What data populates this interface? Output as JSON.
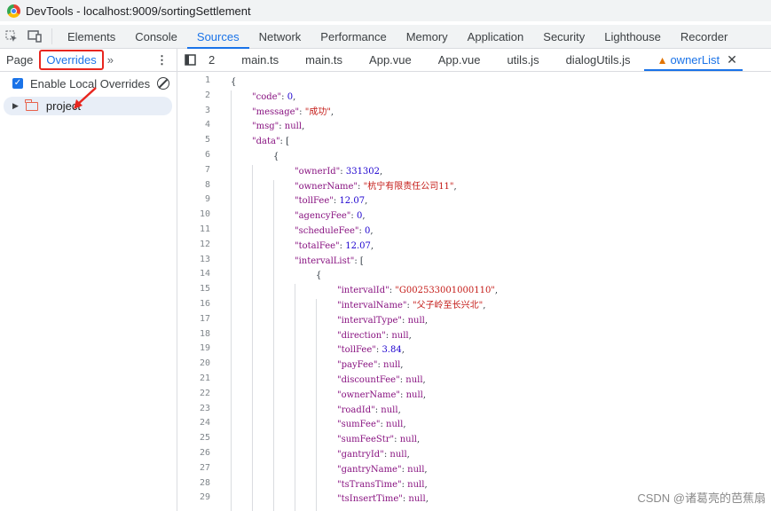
{
  "window": {
    "title": "DevTools - localhost:9009/sortingSettlement"
  },
  "main_tabs": [
    "Elements",
    "Console",
    "Sources",
    "Network",
    "Performance",
    "Memory",
    "Application",
    "Security",
    "Lighthouse",
    "Recorder"
  ],
  "main_tabs_active": "Sources",
  "sub_tabs": {
    "page": "Page",
    "overrides": "Overrides",
    "more": "»",
    "menu": "⋮"
  },
  "file_tabs": [
    "2",
    "main.ts",
    "main.ts",
    "App.vue",
    "App.vue",
    "utils.js",
    "dialogUtils.js",
    "ownerList"
  ],
  "sidebar": {
    "enable_label": "Enable Local Overrides",
    "enabled": true,
    "folder": "project"
  },
  "editor": {
    "line_numbers": [
      "1",
      "2",
      "3",
      "4",
      "5",
      "6",
      "7",
      "8",
      "9",
      "10",
      "11",
      "12",
      "13",
      "14",
      "15",
      "16",
      "17",
      "18",
      "19",
      "20",
      "21",
      "22",
      "23",
      "24",
      "25",
      "26",
      "27",
      "28",
      "29"
    ],
    "lines": [
      {
        "indent": 0,
        "parts": [
          {
            "t": "{",
            "c": "p"
          }
        ]
      },
      {
        "indent": 1,
        "parts": [
          {
            "t": "\"code\"",
            "c": "k"
          },
          {
            "t": ": ",
            "c": "p"
          },
          {
            "t": "0",
            "c": "n"
          },
          {
            "t": ",",
            "c": "p"
          }
        ]
      },
      {
        "indent": 1,
        "parts": [
          {
            "t": "\"message\"",
            "c": "k"
          },
          {
            "t": ": ",
            "c": "p"
          },
          {
            "t": "\"成功\"",
            "c": "s"
          },
          {
            "t": ",",
            "c": "p"
          }
        ]
      },
      {
        "indent": 1,
        "parts": [
          {
            "t": "\"msg\"",
            "c": "k"
          },
          {
            "t": ": ",
            "c": "p"
          },
          {
            "t": "null",
            "c": "k"
          },
          {
            "t": ",",
            "c": "p"
          }
        ]
      },
      {
        "indent": 1,
        "parts": [
          {
            "t": "\"data\"",
            "c": "k"
          },
          {
            "t": ": [",
            "c": "p"
          }
        ]
      },
      {
        "indent": 2,
        "parts": [
          {
            "t": "{",
            "c": "p"
          }
        ]
      },
      {
        "indent": 3,
        "parts": [
          {
            "t": "\"ownerId\"",
            "c": "k"
          },
          {
            "t": ": ",
            "c": "p"
          },
          {
            "t": "331302",
            "c": "n"
          },
          {
            "t": ",",
            "c": "p"
          }
        ]
      },
      {
        "indent": 3,
        "parts": [
          {
            "t": "\"ownerName\"",
            "c": "k"
          },
          {
            "t": ": ",
            "c": "p"
          },
          {
            "t": "\"杭宁有限责任公司11\"",
            "c": "s"
          },
          {
            "t": ",",
            "c": "p"
          }
        ]
      },
      {
        "indent": 3,
        "parts": [
          {
            "t": "\"tollFee\"",
            "c": "k"
          },
          {
            "t": ": ",
            "c": "p"
          },
          {
            "t": "12.07",
            "c": "n"
          },
          {
            "t": ",",
            "c": "p"
          }
        ]
      },
      {
        "indent": 3,
        "parts": [
          {
            "t": "\"agencyFee\"",
            "c": "k"
          },
          {
            "t": ": ",
            "c": "p"
          },
          {
            "t": "0",
            "c": "n"
          },
          {
            "t": ",",
            "c": "p"
          }
        ]
      },
      {
        "indent": 3,
        "parts": [
          {
            "t": "\"scheduleFee\"",
            "c": "k"
          },
          {
            "t": ": ",
            "c": "p"
          },
          {
            "t": "0",
            "c": "n"
          },
          {
            "t": ",",
            "c": "p"
          }
        ]
      },
      {
        "indent": 3,
        "parts": [
          {
            "t": "\"totalFee\"",
            "c": "k"
          },
          {
            "t": ": ",
            "c": "p"
          },
          {
            "t": "12.07",
            "c": "n"
          },
          {
            "t": ",",
            "c": "p"
          }
        ]
      },
      {
        "indent": 3,
        "parts": [
          {
            "t": "\"intervalList\"",
            "c": "k"
          },
          {
            "t": ": [",
            "c": "p"
          }
        ]
      },
      {
        "indent": 4,
        "parts": [
          {
            "t": "{",
            "c": "p"
          }
        ]
      },
      {
        "indent": 5,
        "parts": [
          {
            "t": "\"intervalId\"",
            "c": "k"
          },
          {
            "t": ": ",
            "c": "p"
          },
          {
            "t": "\"G002533001000110\"",
            "c": "s"
          },
          {
            "t": ",",
            "c": "p"
          }
        ]
      },
      {
        "indent": 5,
        "parts": [
          {
            "t": "\"intervalName\"",
            "c": "k"
          },
          {
            "t": ": ",
            "c": "p"
          },
          {
            "t": "\"父子岭至长兴北\"",
            "c": "s"
          },
          {
            "t": ",",
            "c": "p"
          }
        ]
      },
      {
        "indent": 5,
        "parts": [
          {
            "t": "\"intervalType\"",
            "c": "k"
          },
          {
            "t": ": ",
            "c": "p"
          },
          {
            "t": "null",
            "c": "k"
          },
          {
            "t": ",",
            "c": "p"
          }
        ]
      },
      {
        "indent": 5,
        "parts": [
          {
            "t": "\"direction\"",
            "c": "k"
          },
          {
            "t": ": ",
            "c": "p"
          },
          {
            "t": "null",
            "c": "k"
          },
          {
            "t": ",",
            "c": "p"
          }
        ]
      },
      {
        "indent": 5,
        "parts": [
          {
            "t": "\"tollFee\"",
            "c": "k"
          },
          {
            "t": ": ",
            "c": "p"
          },
          {
            "t": "3.84",
            "c": "n"
          },
          {
            "t": ",",
            "c": "p"
          }
        ]
      },
      {
        "indent": 5,
        "parts": [
          {
            "t": "\"payFee\"",
            "c": "k"
          },
          {
            "t": ": ",
            "c": "p"
          },
          {
            "t": "null",
            "c": "k"
          },
          {
            "t": ",",
            "c": "p"
          }
        ]
      },
      {
        "indent": 5,
        "parts": [
          {
            "t": "\"discountFee\"",
            "c": "k"
          },
          {
            "t": ": ",
            "c": "p"
          },
          {
            "t": "null",
            "c": "k"
          },
          {
            "t": ",",
            "c": "p"
          }
        ]
      },
      {
        "indent": 5,
        "parts": [
          {
            "t": "\"ownerName\"",
            "c": "k"
          },
          {
            "t": ": ",
            "c": "p"
          },
          {
            "t": "null",
            "c": "k"
          },
          {
            "t": ",",
            "c": "p"
          }
        ]
      },
      {
        "indent": 5,
        "parts": [
          {
            "t": "\"roadId\"",
            "c": "k"
          },
          {
            "t": ": ",
            "c": "p"
          },
          {
            "t": "null",
            "c": "k"
          },
          {
            "t": ",",
            "c": "p"
          }
        ]
      },
      {
        "indent": 5,
        "parts": [
          {
            "t": "\"sumFee\"",
            "c": "k"
          },
          {
            "t": ": ",
            "c": "p"
          },
          {
            "t": "null",
            "c": "k"
          },
          {
            "t": ",",
            "c": "p"
          }
        ]
      },
      {
        "indent": 5,
        "parts": [
          {
            "t": "\"sumFeeStr\"",
            "c": "k"
          },
          {
            "t": ": ",
            "c": "p"
          },
          {
            "t": "null",
            "c": "k"
          },
          {
            "t": ",",
            "c": "p"
          }
        ]
      },
      {
        "indent": 5,
        "parts": [
          {
            "t": "\"gantryId\"",
            "c": "k"
          },
          {
            "t": ": ",
            "c": "p"
          },
          {
            "t": "null",
            "c": "k"
          },
          {
            "t": ",",
            "c": "p"
          }
        ]
      },
      {
        "indent": 5,
        "parts": [
          {
            "t": "\"gantryName\"",
            "c": "k"
          },
          {
            "t": ": ",
            "c": "p"
          },
          {
            "t": "null",
            "c": "k"
          },
          {
            "t": ",",
            "c": "p"
          }
        ]
      },
      {
        "indent": 5,
        "parts": [
          {
            "t": "\"tsTransTime\"",
            "c": "k"
          },
          {
            "t": ": ",
            "c": "p"
          },
          {
            "t": "null",
            "c": "k"
          },
          {
            "t": ",",
            "c": "p"
          }
        ]
      },
      {
        "indent": 5,
        "parts": [
          {
            "t": "\"tsInsertTime\"",
            "c": "k"
          },
          {
            "t": ": ",
            "c": "p"
          },
          {
            "t": "null",
            "c": "k"
          },
          {
            "t": ",",
            "c": "p"
          }
        ]
      }
    ]
  },
  "watermark": "CSDN @诸葛亮的芭蕉扇",
  "colors": {
    "accent": "#1a73e8",
    "highlight_border": "#e8261f",
    "json_key": "#881280",
    "json_string": "#c41a16",
    "json_number": "#1c00cf"
  }
}
